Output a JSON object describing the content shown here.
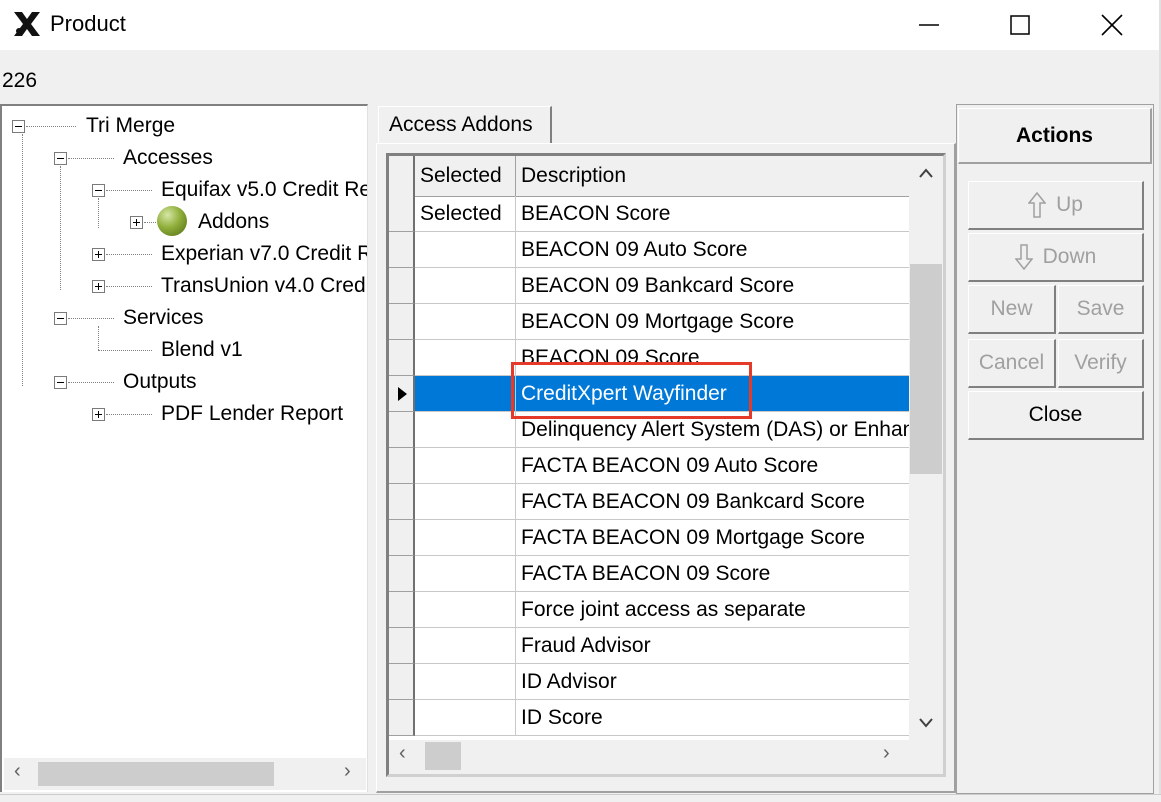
{
  "window": {
    "title": "Product",
    "logo_icon": "x-logo-icon",
    "record_id": "226"
  },
  "tree": {
    "root": "Tri Merge",
    "accesses": "Accesses",
    "equifax": "Equifax v5.0 Credit Re",
    "addons": "Addons",
    "experian": "Experian v7.0 Credit R",
    "transunion": "TransUnion v4.0 Cred",
    "services": "Services",
    "blend": "Blend v1",
    "outputs": "Outputs",
    "pdf_report": "PDF Lender Report"
  },
  "tab": {
    "label": "Access Addons"
  },
  "grid": {
    "columns": [
      "Selected",
      "Description"
    ],
    "rows": [
      {
        "selected": "Selected",
        "description": "BEACON Score"
      },
      {
        "selected": "",
        "description": "BEACON 09 Auto Score"
      },
      {
        "selected": "",
        "description": "BEACON 09 Bankcard Score"
      },
      {
        "selected": "",
        "description": "BEACON 09 Mortgage Score"
      },
      {
        "selected": "",
        "description": "BEACON 09 Score"
      },
      {
        "selected": "",
        "description": "CreditXpert Wayfinder"
      },
      {
        "selected": "",
        "description": "Delinquency Alert System (DAS) or Enhanced"
      },
      {
        "selected": "",
        "description": "FACTA BEACON 09 Auto Score"
      },
      {
        "selected": "",
        "description": "FACTA BEACON 09 Bankcard Score"
      },
      {
        "selected": "",
        "description": "FACTA BEACON 09 Mortgage Score"
      },
      {
        "selected": "",
        "description": "FACTA BEACON 09 Score"
      },
      {
        "selected": "",
        "description": "Force joint access as separate"
      },
      {
        "selected": "",
        "description": "Fraud Advisor"
      },
      {
        "selected": "",
        "description": "ID Advisor"
      },
      {
        "selected": "",
        "description": "ID Score"
      }
    ],
    "selected_row_index": 5,
    "highlight_color": "#0078d7",
    "annotation_color": "#e53a2a"
  },
  "actions": {
    "title": "Actions",
    "up": "Up",
    "down": "Down",
    "new": "New",
    "save": "Save",
    "cancel": "Cancel",
    "verify": "Verify",
    "close": "Close"
  }
}
